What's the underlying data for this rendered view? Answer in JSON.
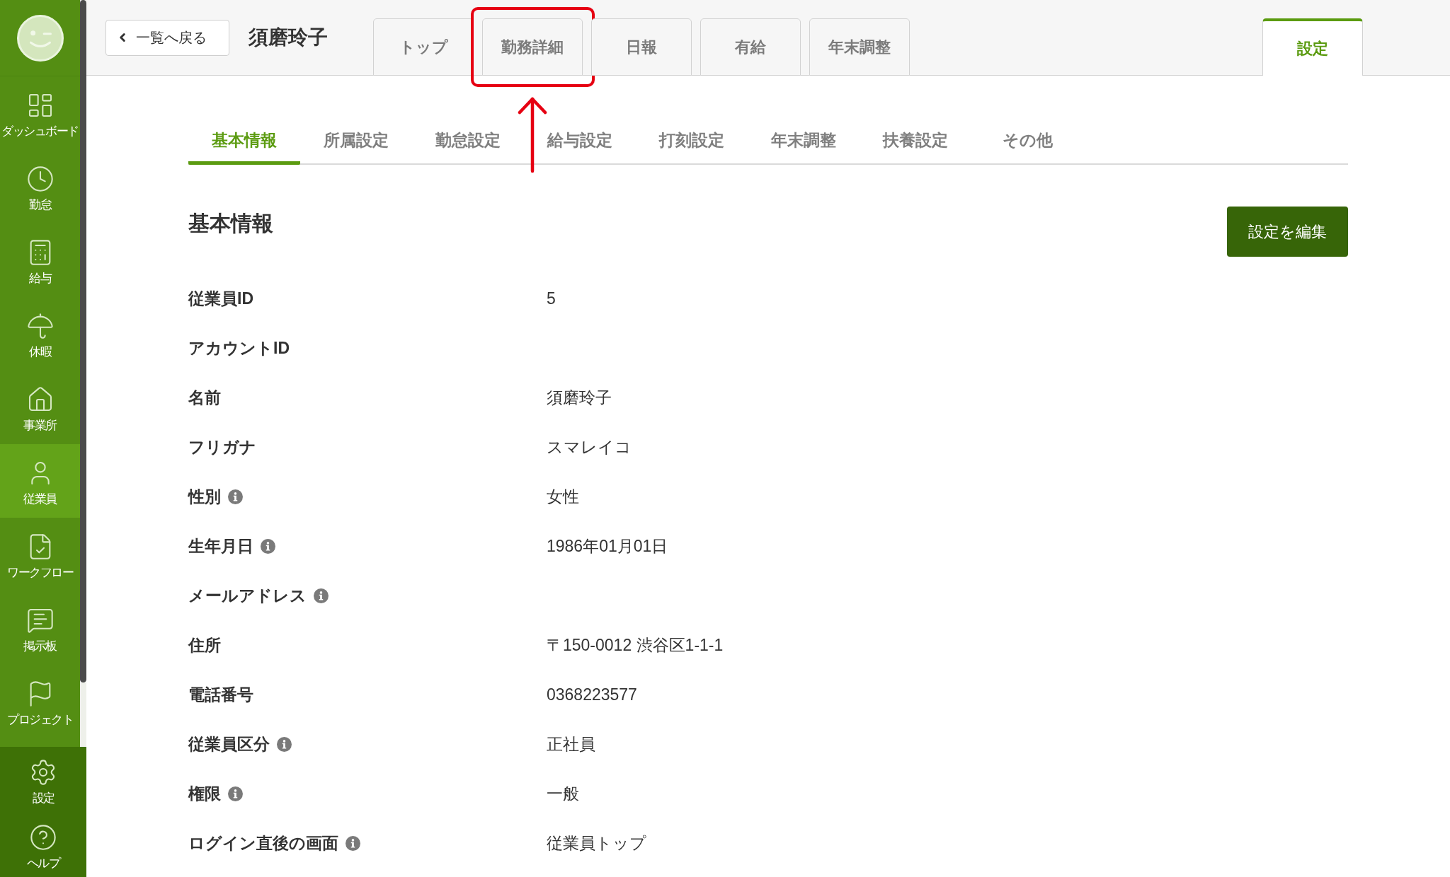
{
  "sidebar": {
    "items": [
      {
        "label": "ダッシュボード",
        "selected": false
      },
      {
        "label": "勤怠",
        "selected": false
      },
      {
        "label": "給与",
        "selected": false
      },
      {
        "label": "休暇",
        "selected": false
      },
      {
        "label": "事業所",
        "selected": false
      },
      {
        "label": "従業員",
        "selected": true
      },
      {
        "label": "ワークフロー",
        "selected": false
      },
      {
        "label": "掲示板",
        "selected": false
      },
      {
        "label": "プロジェクト",
        "selected": false
      }
    ],
    "footer_items": [
      {
        "label": "設定",
        "selected": false
      },
      {
        "label": "ヘルプ",
        "selected": false
      }
    ]
  },
  "header": {
    "back_button": "一覧へ戻る",
    "employee_name": "須磨玲子",
    "tabs": [
      {
        "label": "トップ",
        "selected": false,
        "highlighted": false
      },
      {
        "label": "勤務詳細",
        "selected": false,
        "highlighted": true
      },
      {
        "label": "日報",
        "selected": false,
        "highlighted": false
      },
      {
        "label": "有給",
        "selected": false,
        "highlighted": false
      },
      {
        "label": "年末調整",
        "selected": false,
        "highlighted": false
      }
    ],
    "end_tabs": [
      {
        "label": "設定",
        "selected": true,
        "highlighted": false
      }
    ]
  },
  "subtabs": [
    {
      "label": "基本情報",
      "selected": true
    },
    {
      "label": "所属設定",
      "selected": false
    },
    {
      "label": "勤怠設定",
      "selected": false
    },
    {
      "label": "給与設定",
      "selected": false
    },
    {
      "label": "打刻設定",
      "selected": false
    },
    {
      "label": "年末調整",
      "selected": false
    },
    {
      "label": "扶養設定",
      "selected": false
    },
    {
      "label": "その他",
      "selected": false
    }
  ],
  "section": {
    "title": "基本情報",
    "edit_button": "設定を編集",
    "fields": [
      {
        "label": "従業員ID",
        "value": "5",
        "info": false
      },
      {
        "label": "アカウントID",
        "info": false
      },
      {
        "label": "名前",
        "value": "須磨玲子",
        "info": false
      },
      {
        "label": "フリガナ",
        "value": "スマレイコ",
        "info": false
      },
      {
        "label": "性別",
        "value": "女性",
        "info": true
      },
      {
        "label": "生年月日",
        "value": "1986年01月01日",
        "info": true
      },
      {
        "label": "メールアドレス",
        "info": true
      },
      {
        "label": "住所",
        "value": "〒150-0012 渋谷区1-1-1",
        "info": false
      },
      {
        "label": "電話番号",
        "value": "0368223577",
        "info": false
      },
      {
        "label": "従業員区分",
        "value": "正社員",
        "info": true
      },
      {
        "label": "権限",
        "value": "一般",
        "info": true
      },
      {
        "label": "ログイン直後の画面",
        "value": "従業員トップ",
        "info": true
      }
    ]
  }
}
